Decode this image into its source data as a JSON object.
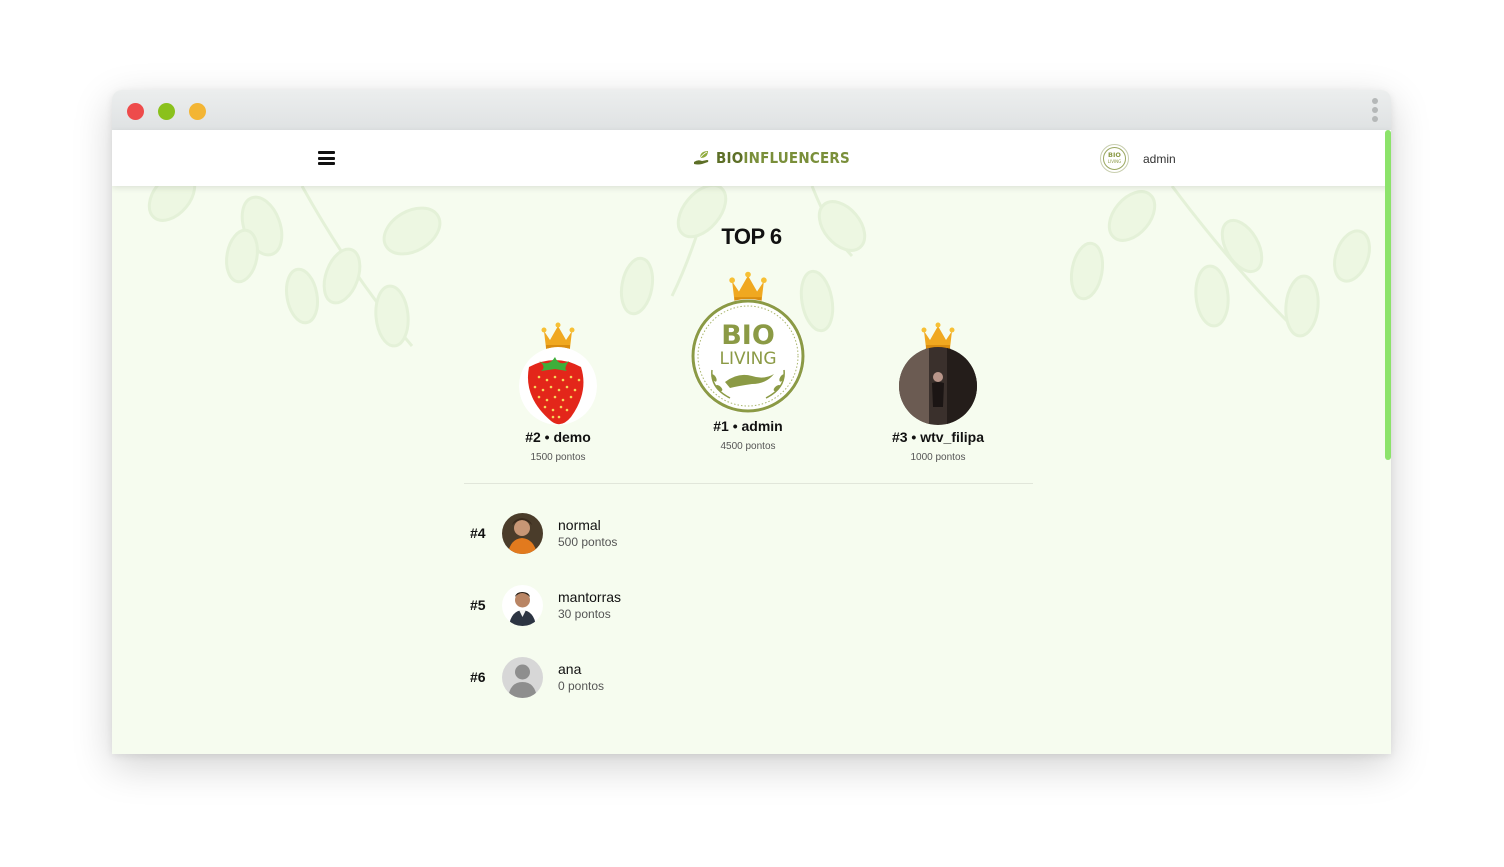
{
  "app": {
    "logo_text_bold": "BIO",
    "logo_text": "INFLUENCERS",
    "user_name": "admin"
  },
  "page": {
    "heading": "TOP 6"
  },
  "podium": [
    {
      "rank_label": "#1 • admin",
      "points": "4500 pontos",
      "avatar": "bio-living-seal"
    },
    {
      "rank_label": "#2 • demo",
      "points": "1500 pontos",
      "avatar": "strawberry"
    },
    {
      "rank_label": "#3 • wtv_filipa",
      "points": "1000 pontos",
      "avatar": "photo-person"
    }
  ],
  "list": [
    {
      "rank": "#4",
      "name": "normal",
      "points": "500 pontos",
      "avatar": "photo-person-orange"
    },
    {
      "rank": "#5",
      "name": "mantorras",
      "points": "30 pontos",
      "avatar": "photo-person-man"
    },
    {
      "rank": "#6",
      "name": "ana",
      "points": "0 pontos",
      "avatar": "default-user"
    }
  ],
  "seal": {
    "top": "BIO",
    "bottom": "LIVING"
  },
  "colors": {
    "accent": "#7a8f3a",
    "crown": "#f0a820",
    "scrollbar": "#8ce36a",
    "background": "#f6fcef"
  }
}
